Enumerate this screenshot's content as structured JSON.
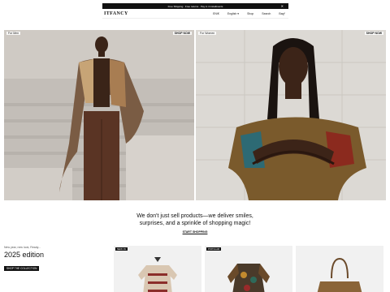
{
  "announcement": {
    "text": "Free Shipping · Free returns · Pay in 4 installments",
    "close_label": "✕"
  },
  "header": {
    "logo": "ITFANCY",
    "links": [
      "EN/€",
      "English ▾",
      "Shop",
      "Search",
      "Bag⁰"
    ]
  },
  "hero": {
    "left": {
      "label": "For Men",
      "shop_label": "SHOP NOW"
    },
    "right": {
      "label": "For Women",
      "shop_label": "SHOP NOW"
    }
  },
  "tagline": {
    "line1": "We don't just sell products—we deliver smiles,",
    "line2": "surprises, and a sprinkle of shopping magic!",
    "link": "START SHOPPING"
  },
  "promo": {
    "small": "New year, new look, Ready...",
    "title": "2025 edition",
    "button": "SHOP THE COLLECTION"
  },
  "products": [
    {
      "badge": "NEW IN"
    },
    {
      "badge": "POPULAR"
    },
    {
      "badge": ""
    }
  ]
}
